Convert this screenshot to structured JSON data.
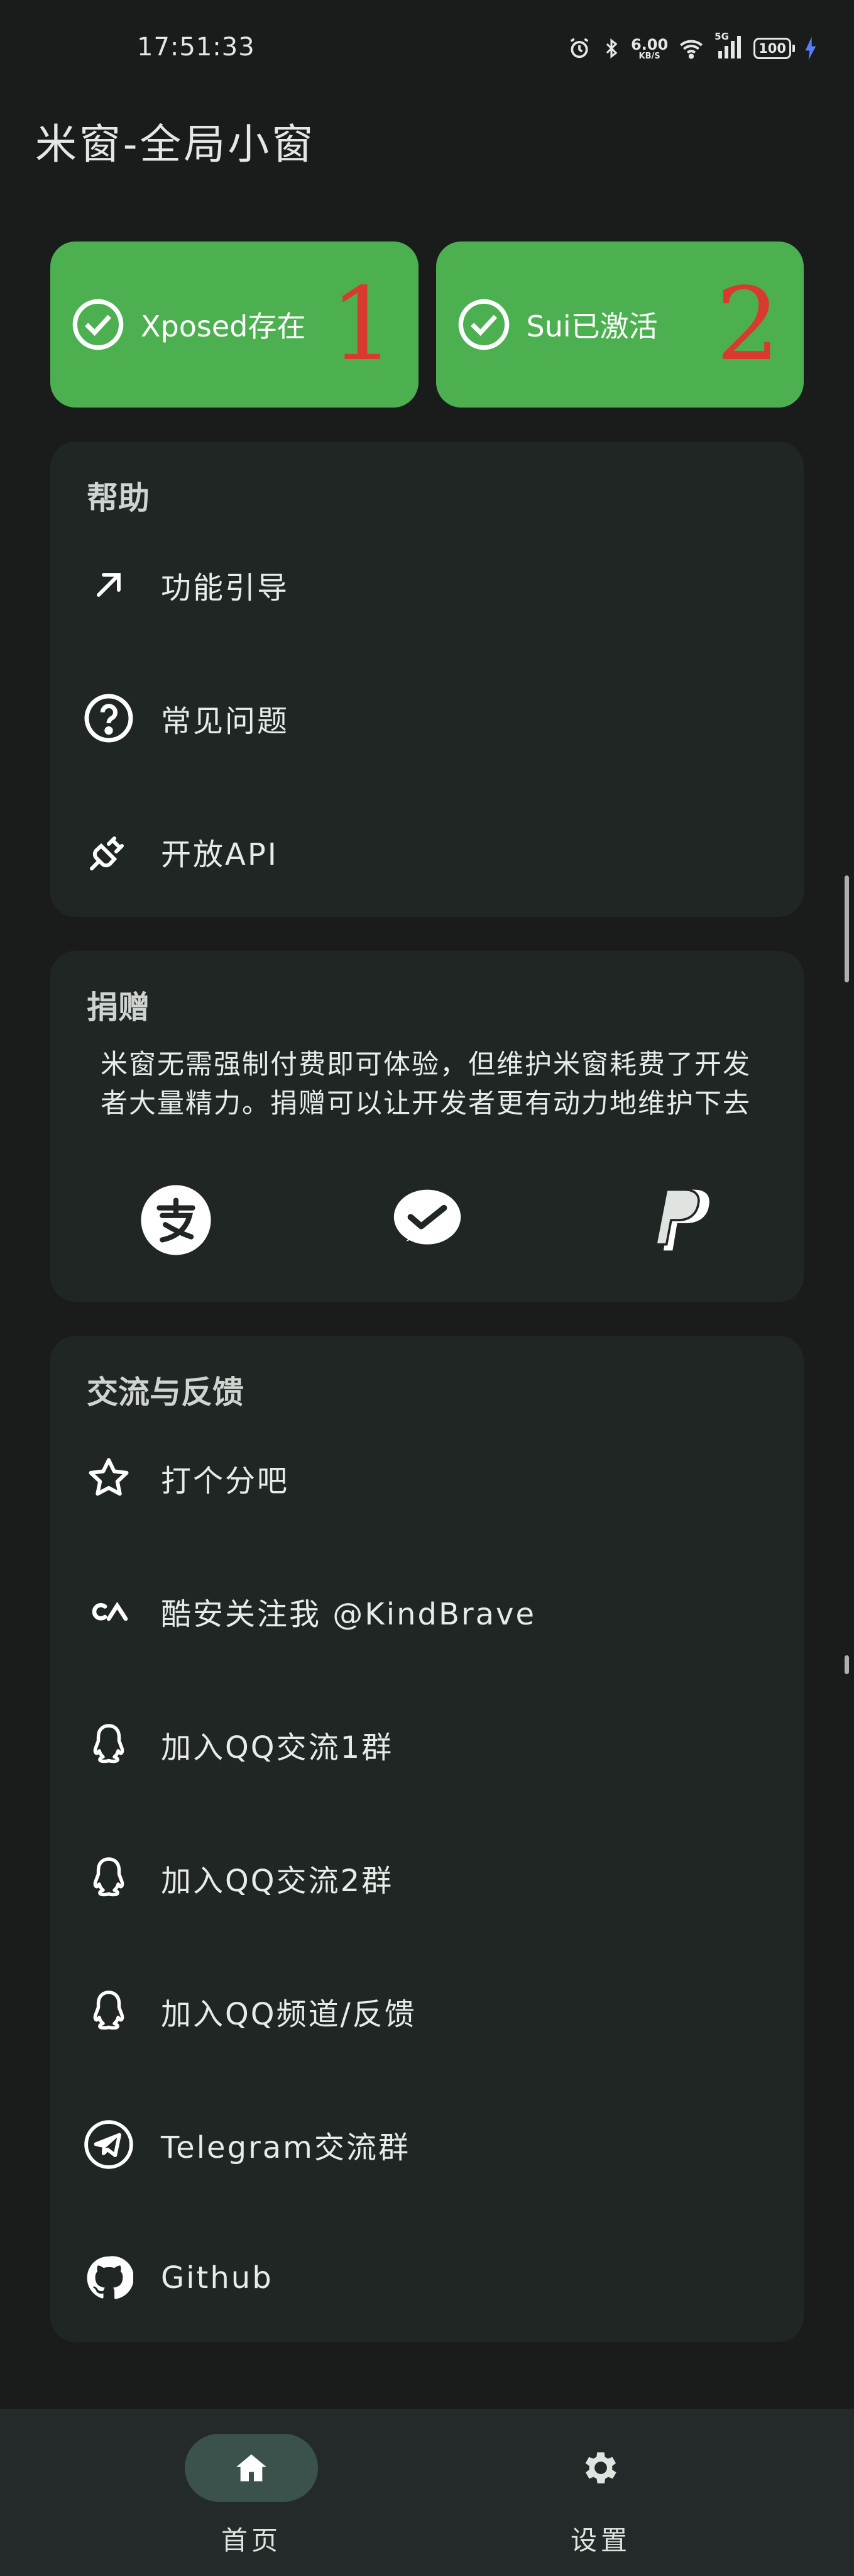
{
  "status_bar": {
    "time": "17:51:33",
    "net_speed": "6.00",
    "net_unit": "KB/S",
    "network": "5G",
    "battery": "100",
    "icons": [
      "alarm-icon",
      "bluetooth-icon",
      "wifi-icon",
      "signal-icon",
      "battery-icon",
      "charging-icon"
    ]
  },
  "app": {
    "title": "米窗-全局小窗"
  },
  "status_cards": [
    {
      "label": "Xposed存在",
      "number": "1",
      "icon": "check-circle-icon"
    },
    {
      "label": "Sui已激活",
      "number": "2",
      "icon": "check-circle-icon"
    }
  ],
  "help": {
    "title": "帮助",
    "items": [
      {
        "label": "功能引导",
        "icon": "arrow-up-right-icon"
      },
      {
        "label": "常见问题",
        "icon": "help-circle-icon"
      },
      {
        "label": "开放API",
        "icon": "plug-icon"
      }
    ]
  },
  "donate": {
    "title": "捐赠",
    "text": "米窗无需强制付费即可体验，但维护米窗耗费了开发者大量精力。捐赠可以让开发者更有动力地维护下去",
    "methods": [
      "alipay-icon",
      "wechat-pay-icon",
      "paypal-icon"
    ]
  },
  "feedback": {
    "title": "交流与反馈",
    "items": [
      {
        "label": "打个分吧",
        "icon": "star-icon"
      },
      {
        "label": "酷安关注我 @KindBrave",
        "icon": "coolapk-icon"
      },
      {
        "label": "加入QQ交流1群",
        "icon": "qq-icon"
      },
      {
        "label": "加入QQ交流2群",
        "icon": "qq-icon"
      },
      {
        "label": "加入QQ频道/反馈",
        "icon": "qq-icon"
      },
      {
        "label": "Telegram交流群",
        "icon": "telegram-icon"
      },
      {
        "label": "Github",
        "icon": "github-icon"
      }
    ]
  },
  "bottom_nav": {
    "items": [
      {
        "label": "首页",
        "icon": "home-icon",
        "active": true
      },
      {
        "label": "设置",
        "icon": "gear-icon",
        "active": false
      }
    ]
  },
  "colors": {
    "background": "#1a1c1c",
    "card": "#202624",
    "success": "#4caf50",
    "annotation": "#d83a30",
    "nav_active": "#3b524c"
  }
}
